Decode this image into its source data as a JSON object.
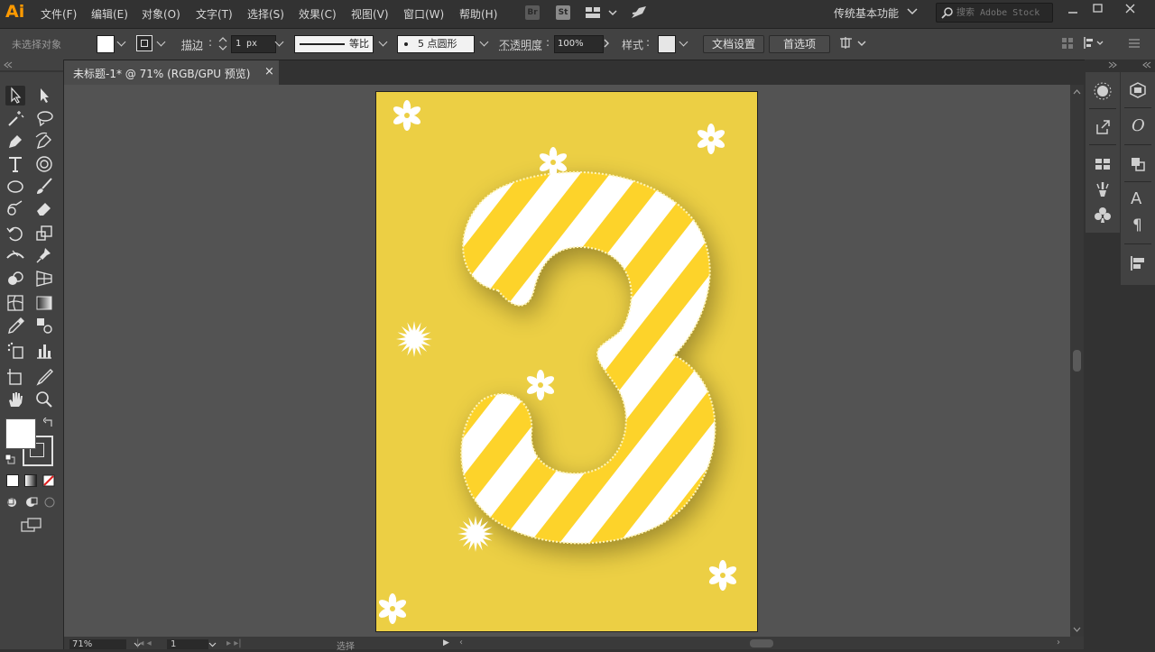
{
  "app": {
    "logo": "Ai"
  },
  "menu": [
    "文件(F)",
    "编辑(E)",
    "对象(O)",
    "文字(T)",
    "选择(S)",
    "效果(C)",
    "视图(V)",
    "窗口(W)",
    "帮助(H)"
  ],
  "menubar": {
    "bridge_label": "Br",
    "stock_label": "St",
    "workspace": "传统基本功能",
    "search_placeholder": "搜索 Adobe Stock"
  },
  "control": {
    "selection_status": "未选择对象",
    "stroke_label": "描边",
    "stroke_weight": "1 px",
    "stroke_profile": "等比",
    "brush": "5 点圆形",
    "opacity_label": "不透明度",
    "opacity_value": "100%",
    "style_label": "样式",
    "doc_setup": "文档设置",
    "preferences": "首选项"
  },
  "document_tab": {
    "title": "未标题-1* @ 71% (RGB/GPU 预览)",
    "close": "×"
  },
  "status": {
    "zoom": "71%",
    "artboard_num": "1",
    "tool_status": "选择"
  },
  "colors": {
    "artboard": "#eccf44",
    "stripe_yellow": "#fdd32b",
    "stripe_white": "#ffffff",
    "logo": "#ff9a00"
  }
}
